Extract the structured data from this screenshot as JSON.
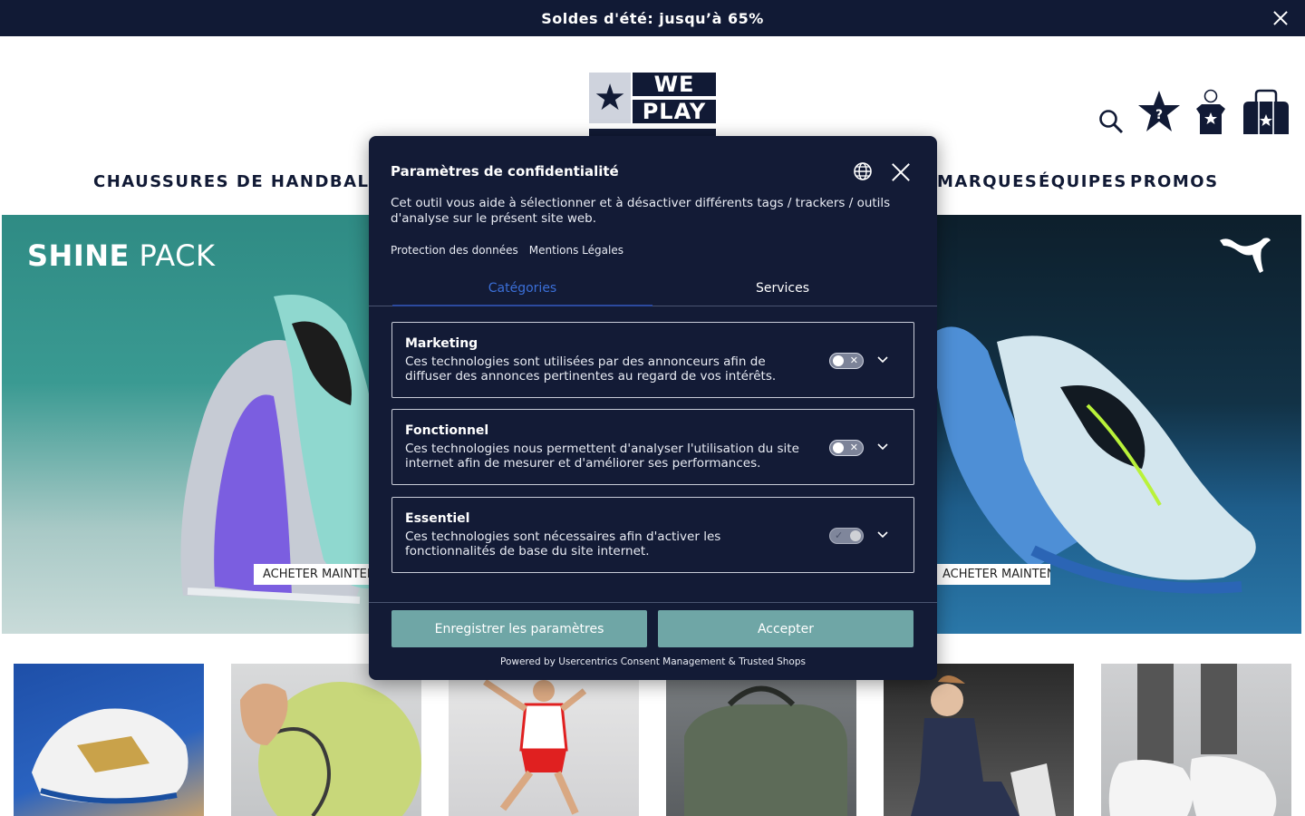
{
  "promo": {
    "text": "Soldes d'été: jusqu’à 65%"
  },
  "logo": {
    "line1": "WE",
    "line2": "PLAY"
  },
  "nav": {
    "items": [
      {
        "label": "CHAUSSURES DE HANDBALL"
      },
      {
        "label": "MARQUES"
      },
      {
        "label": "ÉQUIPES"
      },
      {
        "label": "PROMOS"
      }
    ]
  },
  "hero": {
    "left": {
      "title_bold": "SHINE",
      "title_light": " PACK",
      "button": "ACHETER MAINTENANT"
    },
    "right": {
      "button": "ACHETER MAINTENANT"
    }
  },
  "modal": {
    "title": "Paramètres de confidentialité",
    "description": "Cet outil vous aide à sélectionner et à désactiver différents tags / trackers / outils d'analyse sur le présent site web.",
    "links": [
      "Protection des données",
      "Mentions Légales"
    ],
    "tabs": [
      {
        "label": "Catégories"
      },
      {
        "label": "Services"
      }
    ],
    "categories": [
      {
        "name": "Marketing",
        "description": "Ces technologies sont utilisées par des annonceurs afin de diffuser des annonces pertinentes au regard de vos intérêts.",
        "enabled": false
      },
      {
        "name": "Fonctionnel",
        "description": "Ces technologies nous permettent d'analyser l'utilisation du site internet afin de mesurer et d'améliorer ses performances.",
        "enabled": false
      },
      {
        "name": "Essentiel",
        "description": "Ces technologies sont nécessaires afin d'activer les fonctionnalités de base du site internet.",
        "enabled": true
      }
    ],
    "save_label": "Enregistrer les paramètres",
    "accept_label": "Accepter",
    "powered": "Powered by Usercentrics Consent Management & Trusted Shops"
  },
  "colors": {
    "navy": "#111a35",
    "teal_button": "#6fa6a6",
    "active_tab": "#3b6fd8"
  }
}
